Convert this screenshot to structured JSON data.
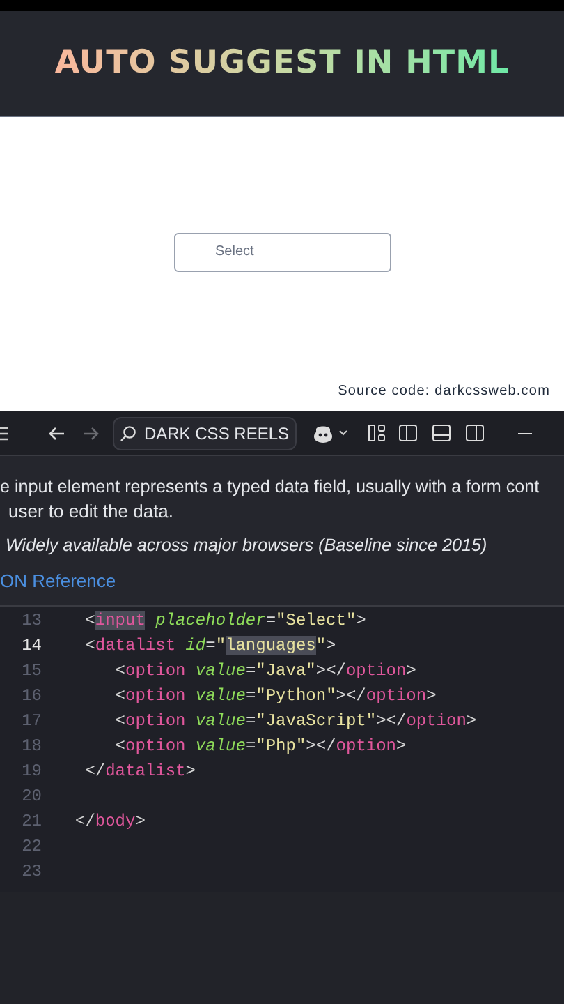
{
  "banner": {
    "title": "AUTO SUGGEST IN HTML"
  },
  "preview": {
    "input": {
      "placeholder": "Select"
    },
    "credit": "Source code: darkcssweb.com"
  },
  "toolbar": {
    "search_label": "DARK CSS REELS",
    "forward_disabled": true
  },
  "hover_doc": {
    "description": [
      "e input element represents a typed data field, usually with a form cont",
      "user to edit the data."
    ],
    "support": "Widely available across major browsers (Baseline since 2015)",
    "link": "ON Reference"
  },
  "code_lines": [
    {
      "number": "13",
      "current": false,
      "tokens": [
        {
          "kind": "punct",
          "text": " <"
        },
        {
          "kind": "tag",
          "text": "input",
          "highlight": true
        },
        {
          "kind": "attr",
          "text": " placeholder"
        },
        {
          "kind": "punct",
          "text": "="
        },
        {
          "kind": "string",
          "text": "\"Select\""
        },
        {
          "kind": "punct",
          "text": ">"
        }
      ]
    },
    {
      "number": "14",
      "current": true,
      "tokens": [
        {
          "kind": "punct",
          "text": " <"
        },
        {
          "kind": "tag",
          "text": "datalist",
          "highlight": false
        },
        {
          "kind": "attr",
          "text": " id"
        },
        {
          "kind": "punct",
          "text": "="
        },
        {
          "kind": "string",
          "text": "\""
        },
        {
          "kind": "string",
          "text": "languages",
          "highlight": true
        },
        {
          "kind": "string",
          "text": "\""
        },
        {
          "kind": "punct",
          "text": ">"
        }
      ]
    },
    {
      "number": "15",
      "current": false,
      "tokens": [
        {
          "kind": "punct",
          "text": "    <"
        },
        {
          "kind": "tag",
          "text": "option"
        },
        {
          "kind": "attr",
          "text": " value"
        },
        {
          "kind": "punct",
          "text": "="
        },
        {
          "kind": "string",
          "text": "\"Java\""
        },
        {
          "kind": "punct",
          "text": "></"
        },
        {
          "kind": "tag",
          "text": "option"
        },
        {
          "kind": "punct",
          "text": ">"
        }
      ]
    },
    {
      "number": "16",
      "current": false,
      "tokens": [
        {
          "kind": "punct",
          "text": "    <"
        },
        {
          "kind": "tag",
          "text": "option"
        },
        {
          "kind": "attr",
          "text": " value"
        },
        {
          "kind": "punct",
          "text": "="
        },
        {
          "kind": "string",
          "text": "\"Python\""
        },
        {
          "kind": "punct",
          "text": "></"
        },
        {
          "kind": "tag",
          "text": "option"
        },
        {
          "kind": "punct",
          "text": ">"
        }
      ]
    },
    {
      "number": "17",
      "current": false,
      "tokens": [
        {
          "kind": "punct",
          "text": "    <"
        },
        {
          "kind": "tag",
          "text": "option"
        },
        {
          "kind": "attr",
          "text": " value"
        },
        {
          "kind": "punct",
          "text": "="
        },
        {
          "kind": "string",
          "text": "\"JavaScript\""
        },
        {
          "kind": "punct",
          "text": "></"
        },
        {
          "kind": "tag",
          "text": "option"
        },
        {
          "kind": "punct",
          "text": ">"
        }
      ]
    },
    {
      "number": "18",
      "current": false,
      "tokens": [
        {
          "kind": "punct",
          "text": "    <"
        },
        {
          "kind": "tag",
          "text": "option"
        },
        {
          "kind": "attr",
          "text": " value"
        },
        {
          "kind": "punct",
          "text": "="
        },
        {
          "kind": "string",
          "text": "\"Php\""
        },
        {
          "kind": "punct",
          "text": "></"
        },
        {
          "kind": "tag",
          "text": "option"
        },
        {
          "kind": "punct",
          "text": ">"
        }
      ]
    },
    {
      "number": "19",
      "current": false,
      "tokens": [
        {
          "kind": "punct",
          "text": " </"
        },
        {
          "kind": "tag",
          "text": "datalist"
        },
        {
          "kind": "punct",
          "text": ">"
        }
      ]
    },
    {
      "number": "20",
      "current": false
    },
    {
      "number": "21",
      "current": false,
      "tokens": [
        {
          "kind": "punct",
          "text": "</"
        },
        {
          "kind": "tag",
          "text": "body"
        },
        {
          "kind": "punct",
          "text": ">"
        }
      ]
    },
    {
      "number": "22",
      "current": false
    },
    {
      "number": "23",
      "current": false
    }
  ]
}
